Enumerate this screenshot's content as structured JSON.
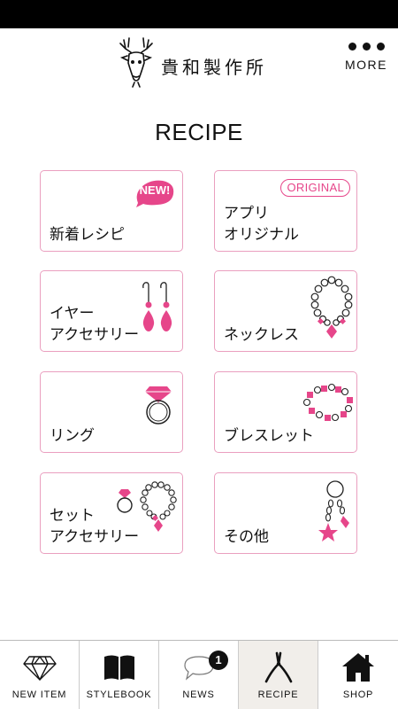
{
  "brand": {
    "name": "貴和製作所",
    "logo_icon": "deer-head-icon"
  },
  "header": {
    "more_label": "MORE",
    "more_icon": "more-dots-icon"
  },
  "page": {
    "title": "RECIPE"
  },
  "categories": [
    {
      "label": "新着レシピ",
      "badge": "NEW!",
      "icon": "new-badge-icon"
    },
    {
      "label": "アプリ\nオリジナル",
      "badge": "ORIGINAL",
      "icon": "original-badge-icon"
    },
    {
      "label": "イヤー\nアクセサリー",
      "icon": "earrings-icon"
    },
    {
      "label": "ネックレス",
      "icon": "necklace-icon"
    },
    {
      "label": "リング",
      "icon": "ring-icon"
    },
    {
      "label": "ブレスレット",
      "icon": "bracelet-icon"
    },
    {
      "label": "セット\nアクセサリー",
      "icon": "jewelry-set-icon"
    },
    {
      "label": "その他",
      "icon": "star-charm-icon"
    }
  ],
  "tabs": [
    {
      "label": "NEW ITEM",
      "icon": "diamond-icon",
      "active": false
    },
    {
      "label": "STYLEBOOK",
      "icon": "book-icon",
      "active": false
    },
    {
      "label": "NEWS",
      "icon": "speech-bubble-icon",
      "badge": "1",
      "active": false
    },
    {
      "label": "RECIPE",
      "icon": "pliers-icon",
      "active": true
    },
    {
      "label": "SHOP",
      "icon": "house-icon",
      "active": false
    }
  ],
  "colors": {
    "accent_pink": "#e6468a",
    "card_border": "#ea9fbf",
    "active_tab_bg": "#f1eeea"
  }
}
